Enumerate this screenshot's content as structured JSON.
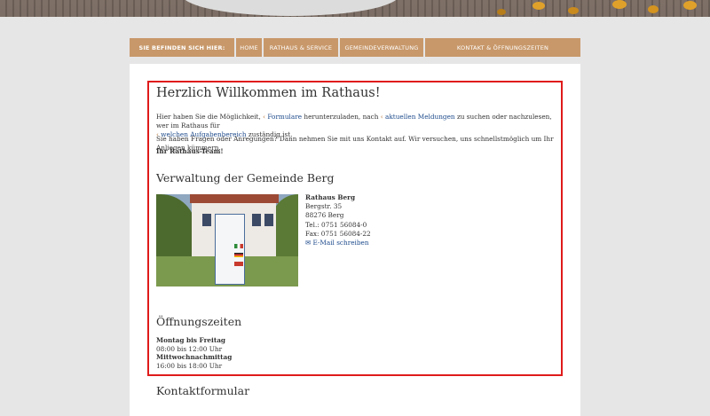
{
  "breadcrumb": {
    "prefix": "SIE BEFINDEN SICH HIER:",
    "items": [
      "HOME",
      "RATHAUS & SERVICE",
      "GEMEINDEVERWALTUNG",
      "KONTAKT & ÖFFNUNGSZEITEN"
    ]
  },
  "welcome": {
    "title": "Herzlich Willkommen im Rathaus!",
    "p1_a": "Hier haben Sie die Möglichkeit,",
    "p1_link1": "Formulare",
    "p1_b": "herunterzuladen, nach",
    "p1_link2": "aktuellen Meldungen",
    "p1_c": "zu suchen oder nachzulesen, wer im Rathaus für",
    "p1_link3": "welchen Aufgabenbereich",
    "p1_d": "zuständig ist.",
    "p2": "Sie haben Fragen oder Anregungen? Dann nehmen Sie mit uns Kontakt auf. Wir versuchen, uns schnellstmöglich um Ihr Anliegen kümmern.",
    "signature": "Ihr Rathaus-Team!"
  },
  "verwaltung": {
    "title": "Verwaltung der Gemeinde Berg",
    "name": "Rathaus Berg",
    "street": "Bergstr. 35",
    "city": "88276 Berg",
    "tel": "Tel.: 0751 56084-0",
    "fax": "Fax: 0751 56084-22",
    "email_label": "E-Mail schreiben"
  },
  "oeffnungszeiten": {
    "title": "Öffnungszeiten",
    "d1": "Montag bis Freitag",
    "t1": "08:00 bis 12:00 Uhr",
    "d2": "Mittwochnachmittag",
    "t2": "16:00 bis 18:00 Uhr"
  },
  "kontakt": {
    "title": "Kontaktformular"
  },
  "colors": {
    "accent": "#c8986a",
    "link": "#1e4b8c",
    "highlight": "#e01b1b"
  },
  "icons": {
    "link_chevron": "chevron-left-icon",
    "mail": "mail-icon"
  }
}
